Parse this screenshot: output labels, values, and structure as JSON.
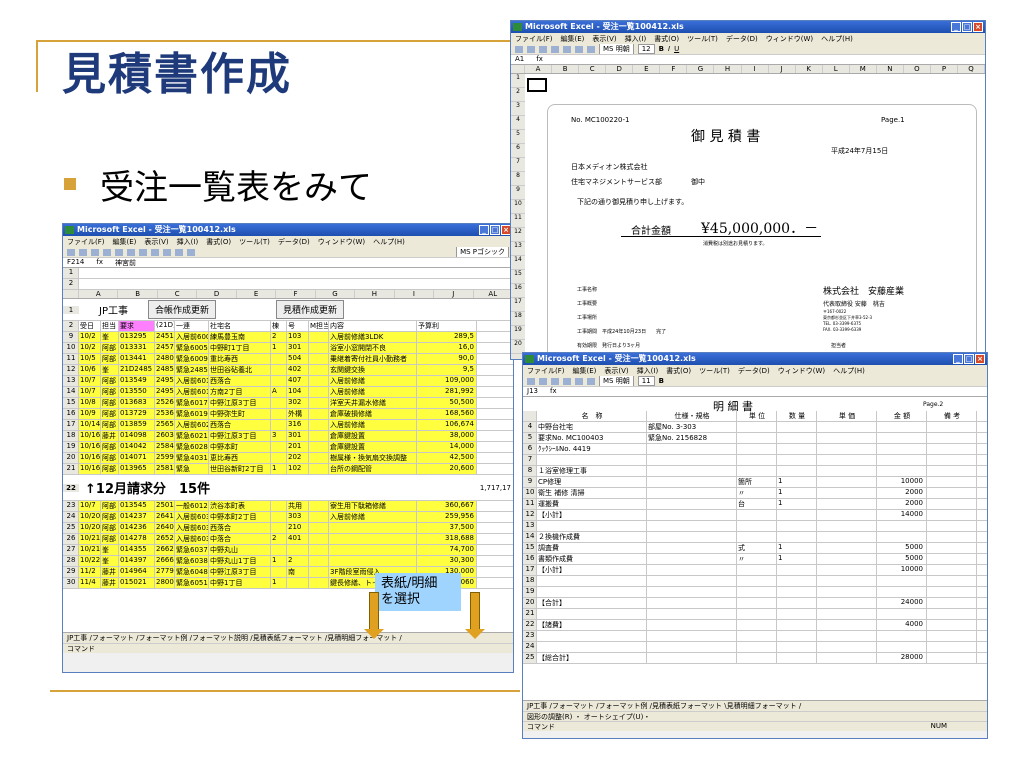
{
  "slide": {
    "title": "見積書作成",
    "bullet": "受注一覧表をみて"
  },
  "callout": {
    "line1": "表紙/明細",
    "line2": "を選択"
  },
  "left_window": {
    "title": "Microsoft Excel - 受注一覧100412.xls",
    "menu": [
      "ファイル(F)",
      "編集(E)",
      "表示(V)",
      "挿入(I)",
      "書式(O)",
      "ツール(T)",
      "データ(D)",
      "ウィンドウ(W)",
      "ヘルプ(H)"
    ],
    "font": "MS Pゴシック",
    "cell_ref": "F214",
    "formula": "神宮前",
    "columns": [
      "A",
      "B",
      "C",
      "D",
      "E",
      "F",
      "G",
      "H",
      "I",
      "J",
      "AL"
    ],
    "header_title": "JP工事",
    "button1": "合帳作成更新",
    "button2": "見積作成更新",
    "col_labels": [
      "受日",
      "担当",
      "要求",
      "(21D)",
      "一連",
      "社宅名",
      "棟",
      "号",
      "M担当",
      "内容",
      "予算利"
    ],
    "rows": [
      {
        "n": "9",
        "c": [
          "10/2",
          "峯",
          "013295",
          "2451",
          "入居前6004",
          "練馬豊玉南",
          "2",
          "103",
          "",
          "入居前修繕3LDK",
          "289,5"
        ]
      },
      {
        "n": "10",
        "c": [
          "10/2",
          "阿部",
          "013331",
          "2457",
          "緊急6005",
          "中野町1丁目",
          "1",
          "301",
          "",
          "浴室小窓開閉不良",
          "16,0"
        ]
      },
      {
        "n": "11",
        "c": [
          "10/5",
          "阿部",
          "013441",
          "2480",
          "緊急6009",
          "重比寿西",
          "",
          "504",
          "",
          "乗継着寄付社員小勤務者",
          "90,0"
        ]
      },
      {
        "n": "12",
        "c": [
          "10/6",
          "峯",
          "21D2485",
          "2485",
          "緊急2485",
          "世田谷砧養北",
          "",
          "402",
          "",
          "玄関鍵交換",
          "9,5"
        ]
      },
      {
        "n": "13",
        "c": [
          "10/7",
          "阿部",
          "013549",
          "2495",
          "入居前6013",
          "西落合",
          "",
          "407",
          "",
          "入居前修繕",
          "109,000"
        ]
      },
      {
        "n": "14",
        "c": [
          "10/7",
          "阿部",
          "013550",
          "2495",
          "入居前6014",
          "方南2丁目",
          "A",
          "104",
          "",
          "入居前修繕",
          "281,992"
        ]
      },
      {
        "n": "15",
        "c": [
          "10/8",
          "阿部",
          "013683",
          "2526",
          "緊急6017",
          "中野江原3丁目",
          "",
          "302",
          "",
          "洋室天井漏水修繕",
          "50,500"
        ]
      },
      {
        "n": "16",
        "c": [
          "10/9",
          "阿部",
          "013729",
          "2536",
          "緊急6019",
          "中野弥生町",
          "",
          "外構",
          "",
          "倉庫破損修繕",
          "168,560"
        ]
      },
      {
        "n": "17",
        "c": [
          "10/14",
          "阿部",
          "013859",
          "2565",
          "入居前6020",
          "西落合",
          "",
          "316",
          "",
          "入居前修繕",
          "106,674"
        ]
      },
      {
        "n": "18",
        "c": [
          "10/16",
          "藤井",
          "014098",
          "2603",
          "緊急6021",
          "中野江原3丁目",
          "3",
          "301",
          "",
          "倉庫鍵設置",
          "38,000"
        ]
      },
      {
        "n": "19",
        "c": [
          "10/16",
          "阿部",
          "014042",
          "2584",
          "緊急6028",
          "中野本町",
          "",
          "201",
          "",
          "倉庫鍵設置",
          "14,000"
        ]
      },
      {
        "n": "20",
        "c": [
          "10/16",
          "阿部",
          "014071",
          "2599",
          "緊急4031",
          "恵比寿西",
          "",
          "202",
          "",
          "樹属様・換気扇交換調整",
          "42,500"
        ]
      },
      {
        "n": "21",
        "c": [
          "10/16",
          "阿部",
          "013965",
          "2581",
          "緊急",
          "世田谷新町2丁目",
          "1",
          "102",
          "",
          "台所の鋼配管",
          "20,600"
        ]
      }
    ],
    "summary_label": "↑12月請求分　15件",
    "summary_total": "1,717,17",
    "rows2": [
      {
        "n": "23",
        "c": [
          "10/7",
          "阿部",
          "013545",
          "2501",
          "一般6012",
          "渋谷本町表",
          "",
          "共用",
          "",
          "寮生用下駄箱修繕",
          "360,667"
        ]
      },
      {
        "n": "24",
        "c": [
          "10/20",
          "阿部",
          "014237",
          "2641",
          "入居前6032",
          "中野本町2丁目",
          "",
          "303",
          "",
          "入居前修繕",
          "259,956"
        ]
      },
      {
        "n": "25",
        "c": [
          "10/20",
          "阿部",
          "014236",
          "2640",
          "入居前6033",
          "西落合",
          "",
          "210",
          "",
          "",
          "37,500"
        ]
      },
      {
        "n": "26",
        "c": [
          "10/21",
          "阿部",
          "014278",
          "2652",
          "入居前6035",
          "中落合",
          "2",
          "401",
          "",
          "",
          "318,688"
        ]
      },
      {
        "n": "27",
        "c": [
          "10/21",
          "峯",
          "014355",
          "2662",
          "緊急6037",
          "中野丸山",
          "",
          "",
          "",
          "",
          "74,700"
        ]
      },
      {
        "n": "28",
        "c": [
          "10/22",
          "峯",
          "014397",
          "2666",
          "緊急6038",
          "中野丸山1丁目",
          "1",
          "2",
          "",
          "",
          "30,300"
        ]
      },
      {
        "n": "29",
        "c": [
          "11/2",
          "藤井",
          "014964",
          "2779",
          "緊急6048",
          "中野江原3丁目",
          "",
          "南",
          "",
          "3F階段室雨侵入",
          "130,000"
        ]
      },
      {
        "n": "30",
        "c": [
          "11/4",
          "藤井",
          "015021",
          "2800",
          "緊急6051",
          "中野1丁目",
          "1",
          "",
          "",
          "鍵長修繕、トイレCP故障",
          "79,060"
        ]
      }
    ],
    "sheet_tabs": "JP工事 /フォーマット /フォーマット例 /フォーマット説明 /見積表紙フォーマット /見積明細フォーマット /",
    "status": "コマンド"
  },
  "top_window": {
    "title": "Microsoft Excel - 受注一覧100412.xls",
    "menu": [
      "ファイル(F)",
      "編集(E)",
      "表示(V)",
      "挿入(I)",
      "書式(O)",
      "ツール(T)",
      "データ(D)",
      "ウィンドウ(W)",
      "ヘルプ(H)"
    ],
    "font": "MS 明朝",
    "size": "12",
    "cell_ref": "A1",
    "columns": [
      "A",
      "B",
      "C",
      "D",
      "E",
      "F",
      "G",
      "H",
      "I",
      "J",
      "K",
      "L",
      "M",
      "N",
      "O",
      "P",
      "Q"
    ],
    "row_numbers": [
      "1",
      "2",
      "3",
      "4",
      "5",
      "6",
      "7",
      "8",
      "9",
      "10",
      "11",
      "12",
      "13",
      "14",
      "15",
      "16",
      "17",
      "18",
      "19",
      "20"
    ],
    "doc": {
      "no": "No. MC100220-1",
      "page": "Page.1",
      "heading": "御 見 積 書",
      "date": "平成24年7月15日",
      "company": "日本メディオン株式会社",
      "dept": "住宅マネジメントサービス部",
      "honorific": "御中",
      "greeting": "下記の通り御見積り申し上げます。",
      "total_label": "合計金額",
      "total_value": "¥45,000,000．－",
      "tax_note": "消費税は別途お見積ります。",
      "field1": "工事名称",
      "field2": "工事概要",
      "field3": "工事場所",
      "field4": "工事期間　平成24年10月23日　　完了",
      "field5": "有効期限　発行日より3ヶ月",
      "vendor": "株式会社　安藤産業",
      "vendor_rep": "代表取締役 安藤　桃吉",
      "vendor_zip": "〒167-0022",
      "vendor_addr": "東京都杉並区下井草3-52-3",
      "vendor_tel": "TEL. 03-3399-6375",
      "vendor_fax": "FAX. 03-3399-6339",
      "vendor_person": "担当者"
    }
  },
  "bottom_window": {
    "title": "Microsoft Excel - 受注一覧100412.xls",
    "menu": [
      "ファイル(F)",
      "編集(E)",
      "表示(V)",
      "挿入(I)",
      "書式(O)",
      "ツール(T)",
      "データ(D)",
      "ウィンドウ(W)",
      "ヘルプ(H)"
    ],
    "font": "MS 明朝",
    "size": "11",
    "cell_ref": "J13",
    "doc_title": "明 細 書",
    "page": "Page.2",
    "headers": [
      "名　称",
      "仕様・規格",
      "単 位",
      "数 量",
      "単 価",
      "金 額",
      "備 考"
    ],
    "rows": [
      {
        "n": "4",
        "c": [
          "中野台社宅",
          "部屋No. 3-303",
          "",
          "",
          "",
          "",
          ""
        ]
      },
      {
        "n": "5",
        "c": [
          "要求No. MC100403",
          "緊急No. 2156828",
          "",
          "",
          "",
          "",
          ""
        ]
      },
      {
        "n": "6",
        "c": [
          "ｸｯｸｼｰﾙNo. 4419",
          "",
          "",
          "",
          "",
          "",
          ""
        ]
      },
      {
        "n": "7",
        "c": [
          "",
          "",
          "",
          "",
          "",
          "",
          ""
        ]
      },
      {
        "n": "8",
        "c": [
          "１浴室修理工事",
          "",
          "",
          "",
          "",
          "",
          ""
        ]
      },
      {
        "n": "9",
        "c": [
          "CP修理",
          "",
          "箇所",
          "1",
          "",
          "10000",
          ""
        ]
      },
      {
        "n": "10",
        "c": [
          "衛生  補修  清掃",
          "",
          "〃",
          "1",
          "",
          "2000",
          ""
        ]
      },
      {
        "n": "11",
        "c": [
          "運搬費",
          "",
          "台",
          "1",
          "",
          "2000",
          ""
        ]
      },
      {
        "n": "12",
        "c": [
          "【小計】",
          "",
          "",
          "",
          "",
          "14000",
          ""
        ]
      },
      {
        "n": "13",
        "c": [
          "",
          "",
          "",
          "",
          "",
          "",
          ""
        ]
      },
      {
        "n": "14",
        "c": [
          "２換機作成費",
          "",
          "",
          "",
          "",
          "",
          ""
        ]
      },
      {
        "n": "15",
        "c": [
          "調査費",
          "",
          "式",
          "1",
          "",
          "5000",
          ""
        ]
      },
      {
        "n": "16",
        "c": [
          "書類作成費",
          "",
          "〃",
          "1",
          "",
          "5000",
          ""
        ]
      },
      {
        "n": "17",
        "c": [
          "【小計】",
          "",
          "",
          "",
          "",
          "10000",
          ""
        ]
      },
      {
        "n": "18",
        "c": [
          "",
          "",
          "",
          "",
          "",
          "",
          ""
        ]
      },
      {
        "n": "19",
        "c": [
          "",
          "",
          "",
          "",
          "",
          "",
          ""
        ]
      },
      {
        "n": "20",
        "c": [
          "【合計】",
          "",
          "",
          "",
          "",
          "24000",
          ""
        ]
      },
      {
        "n": "21",
        "c": [
          "",
          "",
          "",
          "",
          "",
          "",
          ""
        ]
      },
      {
        "n": "22",
        "c": [
          "【諸費】",
          "",
          "",
          "",
          "",
          "4000",
          ""
        ]
      },
      {
        "n": "23",
        "c": [
          "",
          "",
          "",
          "",
          "",
          "",
          ""
        ]
      },
      {
        "n": "24",
        "c": [
          "",
          "",
          "",
          "",
          "",
          "",
          ""
        ]
      },
      {
        "n": "25",
        "c": [
          "【総合計】",
          "",
          "",
          "",
          "",
          "28000",
          ""
        ]
      }
    ],
    "sheet_tabs": "JP工事 /フォーマット /フォーマット例 /見積表紙フォーマット \\見積明細フォーマット /",
    "draw_bar": "図形の調整(R) ・ オートシェイプ(U)・",
    "status": "コマンド",
    "num": "NUM"
  }
}
